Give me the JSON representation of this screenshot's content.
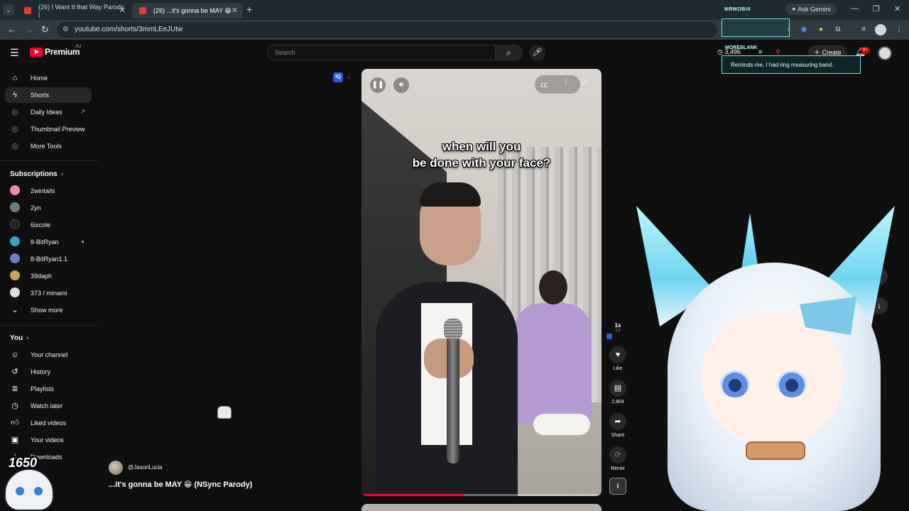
{
  "browser": {
    "tabs": [
      {
        "title": "(26) I Want It that Way Parody |",
        "active": false
      },
      {
        "title": "(26) ...it's gonna be MAY 😁",
        "active": true
      }
    ],
    "url": "youtube.com/shorts/3mmLEeJUtw",
    "ask_gemini": "Ask Gemini"
  },
  "overlay": {
    "top_label": "MRMOBIX",
    "second_label": "MOREBLANK",
    "message": "Reminds me, I had ring measuring band."
  },
  "header": {
    "logo_text": "Premium",
    "country": "AU",
    "search_placeholder": "Search",
    "counter": "3,496",
    "create_label": "Create",
    "notif_badge": "9+"
  },
  "sidebar": {
    "main": [
      {
        "label": "Home",
        "icon": "home-icon"
      },
      {
        "label": "Shorts",
        "icon": "shorts-icon"
      },
      {
        "label": "Daily Ideas",
        "icon": "extension-icon"
      },
      {
        "label": "Thumbnail Preview",
        "icon": "extension-icon"
      },
      {
        "label": "More Tools",
        "icon": "extension-icon"
      }
    ],
    "subscriptions_heading": "Subscriptions",
    "subscriptions": [
      {
        "label": "2wintails",
        "color": "#e78fb3"
      },
      {
        "label": "2yn",
        "color": "#6c7a89"
      },
      {
        "label": "6ixcole",
        "color": "#222222"
      },
      {
        "label": "8-BitRyan",
        "color": "#3aa0c8"
      },
      {
        "label": "8-BitRyan1.1",
        "color": "#6b7fbf"
      },
      {
        "label": "39daph",
        "color": "#c9a45c"
      },
      {
        "label": "373 / minami",
        "color": "#dddddd"
      }
    ],
    "show_more": "Show more",
    "you_heading": "You",
    "you": [
      {
        "label": "Your channel",
        "icon": "channel-icon"
      },
      {
        "label": "History",
        "icon": "history-icon"
      },
      {
        "label": "Playlists",
        "icon": "playlists-icon"
      },
      {
        "label": "Watch later",
        "icon": "clock-icon"
      },
      {
        "label": "Liked videos",
        "icon": "thumbs-up-icon"
      },
      {
        "label": "Your videos",
        "icon": "video-icon"
      },
      {
        "label": "Downloads",
        "icon": "download-icon"
      }
    ]
  },
  "video": {
    "caption_line1": "when will you",
    "caption_line2": "be done with your face?",
    "progress": 0.43,
    "channel": "@JasonLucia",
    "title": "...it's gonna be MAY 😁 (NSync Parody)"
  },
  "actions": {
    "speed": "1x",
    "speed_sub": "1.0",
    "like_label": "Like",
    "comments_count": "2,804",
    "share_label": "Share",
    "remix_label": "Remix"
  },
  "vtuber_mini": {
    "score": "1650"
  }
}
